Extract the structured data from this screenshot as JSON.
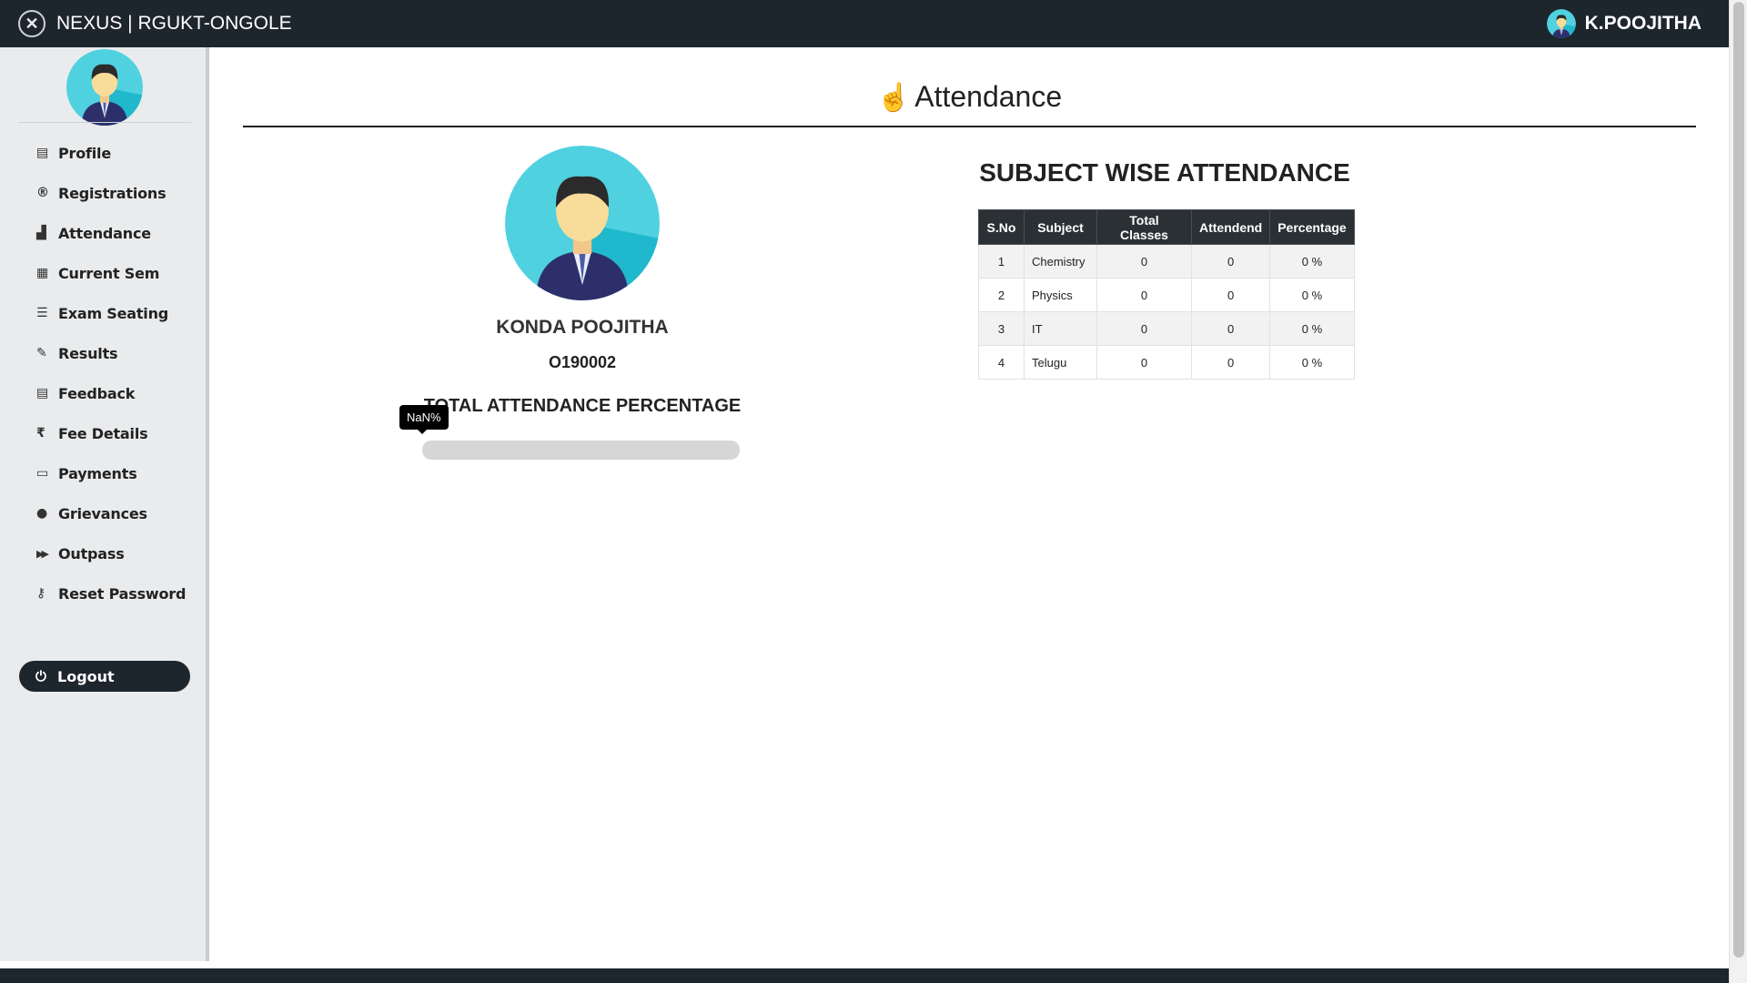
{
  "header": {
    "brand_title": "NEXUS | RGUKT-ONGOLE",
    "user_name": "K.POOJITHA"
  },
  "sidebar": {
    "items": [
      {
        "label": "Profile",
        "icon": "id-card-icon",
        "glyph": "▤"
      },
      {
        "label": "Registrations",
        "icon": "registered-icon",
        "glyph": "®"
      },
      {
        "label": "Attendance",
        "icon": "bar-chart-icon",
        "glyph": "▟"
      },
      {
        "label": "Current Sem",
        "icon": "table-icon",
        "glyph": "▦"
      },
      {
        "label": "Exam Seating",
        "icon": "sliders-icon",
        "glyph": "☰"
      },
      {
        "label": "Results",
        "icon": "edit-icon",
        "glyph": "✎"
      },
      {
        "label": "Feedback",
        "icon": "list-alt-icon",
        "glyph": "▤"
      },
      {
        "label": "Fee Details",
        "icon": "rupee-icon",
        "glyph": "₹"
      },
      {
        "label": "Payments",
        "icon": "credit-card-icon",
        "glyph": "▭"
      },
      {
        "label": "Grievances",
        "icon": "comment-icon",
        "glyph": "●"
      },
      {
        "label": "Outpass",
        "icon": "fast-forward-icon",
        "glyph": "▶▶"
      },
      {
        "label": "Reset Password",
        "icon": "key-icon",
        "glyph": "⚷"
      }
    ],
    "logout_label": "Logout"
  },
  "main": {
    "page_title": "Attendance",
    "student_name": "KONDA POOJITHA",
    "student_id": "O190002",
    "total_label": "TOTAL ATTENDANCE PERCENTAGE",
    "progress_tooltip": "NaN%",
    "progress_fraction": 0
  },
  "subjects": {
    "title": "SUBJECT WISE ATTENDANCE",
    "headers": [
      "S.No",
      "Subject",
      "Total Classes",
      "Attendend",
      "Percentage"
    ],
    "rows": [
      {
        "sno": "1",
        "subject": "Chemistry",
        "total": "0",
        "attended": "0",
        "percentage": "0 %"
      },
      {
        "sno": "2",
        "subject": "Physics",
        "total": "0",
        "attended": "0",
        "percentage": "0 %"
      },
      {
        "sno": "3",
        "subject": "IT",
        "total": "0",
        "attended": "0",
        "percentage": "0 %"
      },
      {
        "sno": "4",
        "subject": "Telugu",
        "total": "0",
        "attended": "0",
        "percentage": "0 %"
      }
    ]
  },
  "colors": {
    "navbar": "#1d252d",
    "sidebar_bg": "#e9ebed",
    "avatar_bg": "#4fd1e0"
  }
}
